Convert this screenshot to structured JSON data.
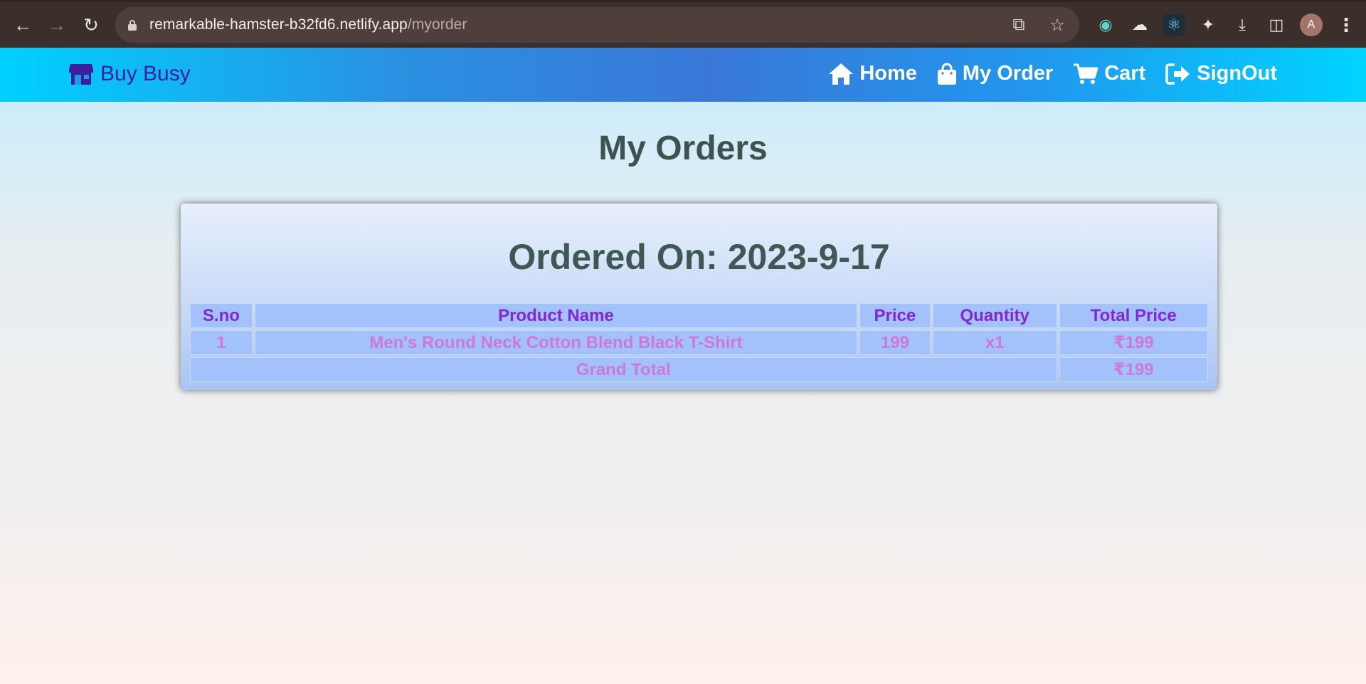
{
  "browser": {
    "url_host": "remarkable-hamster-b32fd6.netlify.app",
    "url_path": "/myorder",
    "profile_initial": "A"
  },
  "navbar": {
    "brand": "Buy Busy",
    "links": [
      {
        "label": "Home",
        "icon": "home-icon"
      },
      {
        "label": "My Order",
        "icon": "shopping-bag-icon"
      },
      {
        "label": "Cart",
        "icon": "cart-icon"
      },
      {
        "label": "SignOut",
        "icon": "signout-icon"
      }
    ]
  },
  "page": {
    "title": "My Orders"
  },
  "order": {
    "ordered_on_label": "Ordered On: 2023-9-17",
    "columns": [
      "S.no",
      "Product Name",
      "Price",
      "Quantity",
      "Total Price"
    ],
    "rows": [
      {
        "sno": "1",
        "product": "Men's Round Neck Cotton Blend Black T-Shirt",
        "price": "199",
        "quantity": "x1",
        "total": "₹199"
      }
    ],
    "grand_total_label": "Grand Total",
    "grand_total_value": "₹199"
  },
  "colors": {
    "navbar_gradient_edge": "#00d1ff",
    "navbar_gradient_center": "#3a78d8",
    "brand_text": "#3d1f9a",
    "header_text": "#8326d9",
    "cell_text": "#cc7ad6",
    "table_cell_bg": "#a3c1fb",
    "title_text": "#3c5450"
  }
}
